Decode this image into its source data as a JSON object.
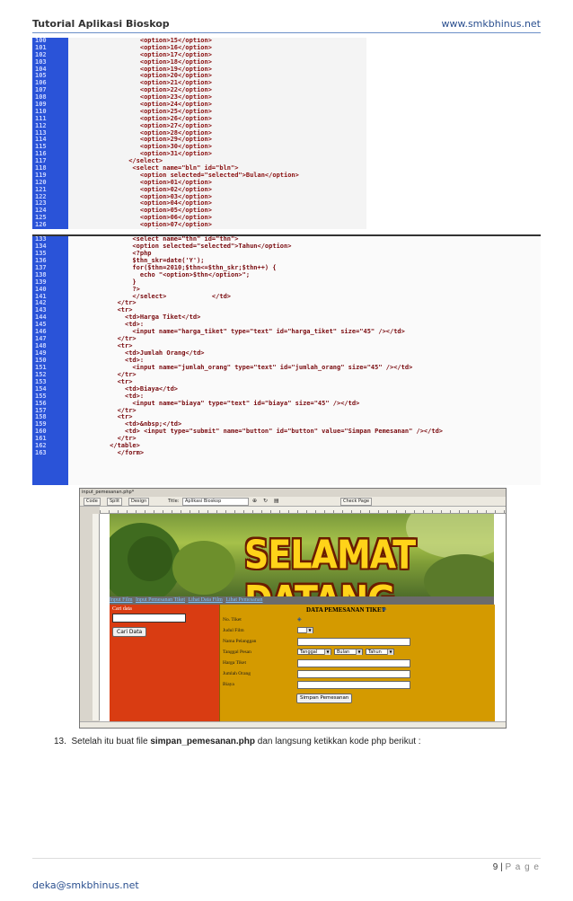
{
  "header": {
    "left": "Tutorial Aplikasi Bioskop",
    "right": "www.smkbhinus.net"
  },
  "code_block_1": [
    {
      "n": "100",
      "t": "                  <option>15</option>"
    },
    {
      "n": "101",
      "t": "                  <option>16</option>"
    },
    {
      "n": "102",
      "t": "                  <option>17</option>"
    },
    {
      "n": "103",
      "t": "                  <option>18</option>"
    },
    {
      "n": "104",
      "t": "                  <option>19</option>"
    },
    {
      "n": "105",
      "t": "                  <option>20</option>"
    },
    {
      "n": "106",
      "t": "                  <option>21</option>"
    },
    {
      "n": "107",
      "t": "                  <option>22</option>"
    },
    {
      "n": "108",
      "t": "                  <option>23</option>"
    },
    {
      "n": "109",
      "t": "                  <option>24</option>"
    },
    {
      "n": "110",
      "t": "                  <option>25</option>"
    },
    {
      "n": "111",
      "t": "                  <option>26</option>"
    },
    {
      "n": "112",
      "t": "                  <option>27</option>"
    },
    {
      "n": "113",
      "t": "                  <option>28</option>"
    },
    {
      "n": "114",
      "t": "                  <option>29</option>"
    },
    {
      "n": "115",
      "t": "                  <option>30</option>"
    },
    {
      "n": "116",
      "t": "                  <option>31</option>"
    },
    {
      "n": "117",
      "t": "               </select>"
    },
    {
      "n": "118",
      "t": "                <select name=\"bln\" id=\"bln\">"
    },
    {
      "n": "119",
      "t": "                  <option selected=\"selected\">Bulan</option>"
    },
    {
      "n": "120",
      "t": "                  <option>01</option>"
    },
    {
      "n": "121",
      "t": "                  <option>02</option>"
    },
    {
      "n": "122",
      "t": "                  <option>03</option>"
    },
    {
      "n": "123",
      "t": "                  <option>04</option>"
    },
    {
      "n": "124",
      "t": "                  <option>05</option>"
    },
    {
      "n": "125",
      "t": "                  <option>06</option>"
    },
    {
      "n": "126",
      "t": "                  <option>07</option>"
    },
    {
      "n": "127",
      "t": "                  <option>08</option>"
    },
    {
      "n": "128",
      "t": "                  <option>09</option>"
    },
    {
      "n": "129",
      "t": "                  <option>10</option>"
    },
    {
      "n": "130",
      "t": "                  <option>11</option>"
    },
    {
      "n": "131",
      "t": "                  <option>12</option>"
    },
    {
      "n": "132",
      "t": "               </select>"
    }
  ],
  "code_block_2": [
    {
      "n": "133",
      "t": "                <select name=\"thn\" id=\"thn\">"
    },
    {
      "n": "134",
      "t": "                <option selected=\"selected\">Tahun</option>"
    },
    {
      "n": "135",
      "t": "                <?php"
    },
    {
      "n": "136",
      "t": "                $thn_skr=date('Y');"
    },
    {
      "n": "137",
      "t": "                for($thn=2010;$thn<=$thn_skr;$thn++) {"
    },
    {
      "n": "138",
      "t": "                  echo \"<option>$thn</option>\";"
    },
    {
      "n": "139",
      "t": "                }"
    },
    {
      "n": "140",
      "t": "                ?>"
    },
    {
      "n": "141",
      "t": "                </select>            </td>"
    },
    {
      "n": "142",
      "t": "            </tr>"
    },
    {
      "n": "143",
      "t": "            <tr>"
    },
    {
      "n": "144",
      "t": "              <td>Harga Tiket</td>"
    },
    {
      "n": "145",
      "t": "              <td>:"
    },
    {
      "n": "146",
      "t": "                <input name=\"harga_tiket\" type=\"text\" id=\"harga_tiket\" size=\"45\" /></td>"
    },
    {
      "n": "147",
      "t": "            </tr>"
    },
    {
      "n": "148",
      "t": "            <tr>"
    },
    {
      "n": "149",
      "t": "              <td>Jumlah Orang</td>"
    },
    {
      "n": "150",
      "t": "              <td>:"
    },
    {
      "n": "151",
      "t": "                <input name=\"jumlah_orang\" type=\"text\" id=\"jumlah_orang\" size=\"45\" /></td>"
    },
    {
      "n": "152",
      "t": "            </tr>"
    },
    {
      "n": "153",
      "t": "            <tr>"
    },
    {
      "n": "154",
      "t": "              <td>Biaya</td>"
    },
    {
      "n": "155",
      "t": "              <td>:"
    },
    {
      "n": "156",
      "t": "                <input name=\"biaya\" type=\"text\" id=\"biaya\" size=\"45\" /></td>"
    },
    {
      "n": "157",
      "t": "            </tr>"
    },
    {
      "n": "158",
      "t": "            <tr>"
    },
    {
      "n": "159",
      "t": "              <td>&nbsp;</td>"
    },
    {
      "n": "160",
      "t": "              <td> <input type=\"submit\" name=\"button\" id=\"button\" value=\"Simpan Pemesanan\" /></td>"
    },
    {
      "n": "161",
      "t": "            </tr>"
    },
    {
      "n": "162",
      "t": "          </table>"
    },
    {
      "n": "163",
      "t": "            </form>"
    }
  ],
  "screenshot": {
    "doc_tab": "input_pemesanan.php*",
    "toolbar": {
      "code": "Code",
      "split": "Split",
      "design": "Design",
      "title_label": "Title:",
      "title_value": "Aplikasi Bioskop",
      "check_page": "Check Page"
    },
    "banner_title": "SELAMAT DATANG",
    "nav_links": [
      "Input Film",
      "Input Pemesanan Tiket",
      "Lihat Data Film",
      "Lihat Pemesanan"
    ],
    "sidebar": {
      "label": "Cari data",
      "button": "Cari Data"
    },
    "form": {
      "title": "DATA PEMESANAN TIKET",
      "labels": [
        "No. Tiket",
        "Judul Film",
        "Nama Pelanggan",
        "Tanggal Pesan",
        "Harga Tiket",
        "Jumlah Orang",
        "Biaya"
      ],
      "tanggal": "Tanggal",
      "bulan": "Bulan",
      "tahun": "Tahun",
      "submit": "Simpan Pemesanan"
    }
  },
  "paragraph": {
    "number": "13.",
    "before": "Setelah itu buat file ",
    "file": "simpan_pemesanan.php",
    "after": " dan langsung ketikkan kode php berikut :"
  },
  "footer": {
    "page_number": "9",
    "page_label": "P a g e",
    "email": "deka@smkbhinus.net"
  }
}
